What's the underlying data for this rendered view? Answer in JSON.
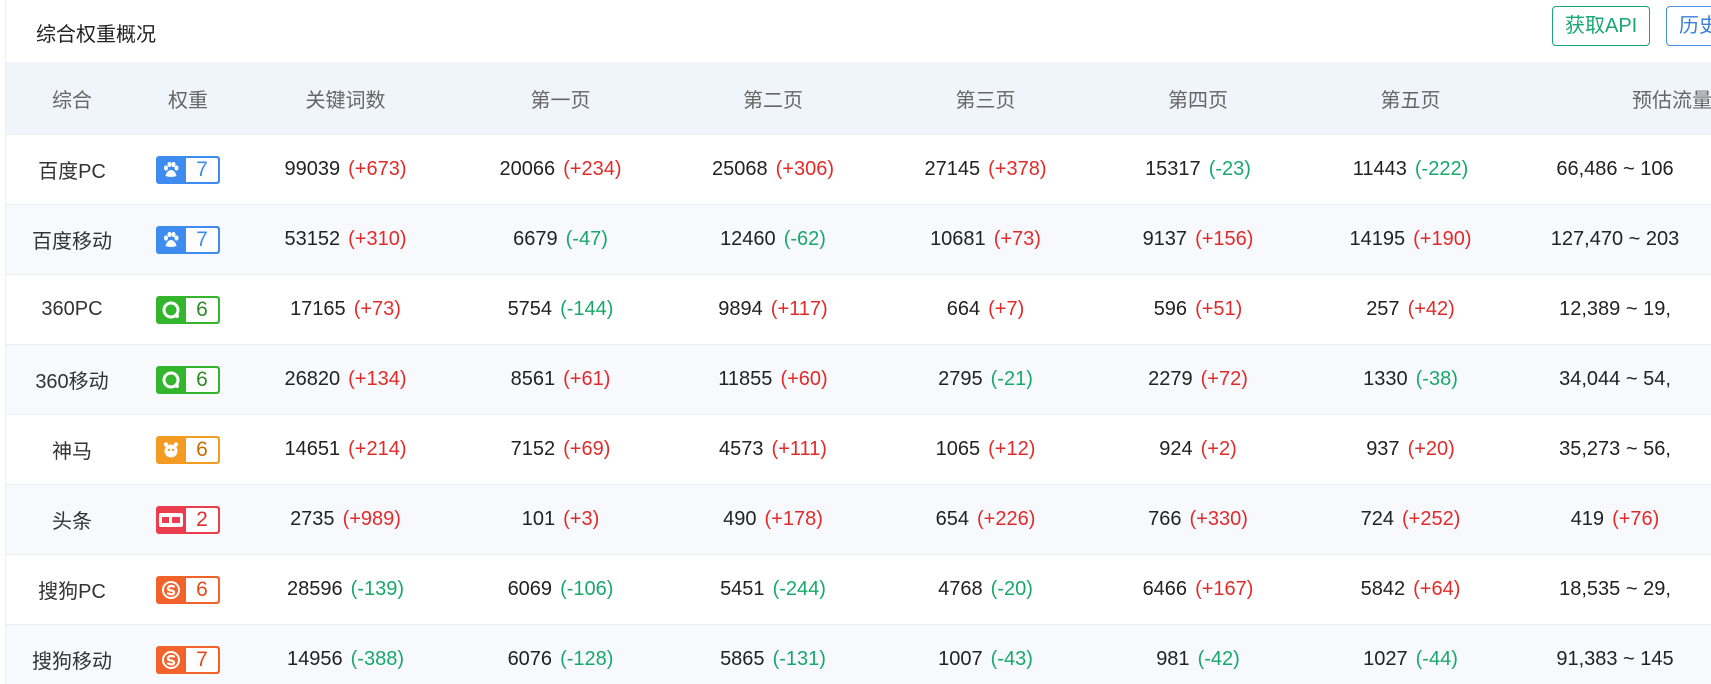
{
  "header": {
    "title": "综合权重概况",
    "api_button": "获取API",
    "history_button": "历史"
  },
  "columns": [
    "综合",
    "权重",
    "关键词数",
    "第一页",
    "第二页",
    "第三页",
    "第四页",
    "第五页",
    "预估流量"
  ],
  "rows": [
    {
      "engine": "百度PC",
      "weight": "7",
      "kw": "99039",
      "kw_d": "(+673)",
      "p1": "20066",
      "p1_d": "(+234)",
      "p2": "25068",
      "p2_d": "(+306)",
      "p3": "27145",
      "p3_d": "(+378)",
      "p4": "15317",
      "p4_d": "(-23)",
      "p5": "11443",
      "p5_d": "(-222)",
      "traffic": "66,486 ~ 106"
    },
    {
      "engine": "百度移动",
      "weight": "7",
      "kw": "53152",
      "kw_d": "(+310)",
      "p1": "6679",
      "p1_d": "(-47)",
      "p2": "12460",
      "p2_d": "(-62)",
      "p3": "10681",
      "p3_d": "(+73)",
      "p4": "9137",
      "p4_d": "(+156)",
      "p5": "14195",
      "p5_d": "(+190)",
      "traffic": "127,470 ~ 203"
    },
    {
      "engine": "360PC",
      "weight": "6",
      "kw": "17165",
      "kw_d": "(+73)",
      "p1": "5754",
      "p1_d": "(-144)",
      "p2": "9894",
      "p2_d": "(+117)",
      "p3": "664",
      "p3_d": "(+7)",
      "p4": "596",
      "p4_d": "(+51)",
      "p5": "257",
      "p5_d": "(+42)",
      "traffic": "12,389 ~ 19,"
    },
    {
      "engine": "360移动",
      "weight": "6",
      "kw": "26820",
      "kw_d": "(+134)",
      "p1": "8561",
      "p1_d": "(+61)",
      "p2": "11855",
      "p2_d": "(+60)",
      "p3": "2795",
      "p3_d": "(-21)",
      "p4": "2279",
      "p4_d": "(+72)",
      "p5": "1330",
      "p5_d": "(-38)",
      "traffic": "34,044 ~ 54,"
    },
    {
      "engine": "神马",
      "weight": "6",
      "kw": "14651",
      "kw_d": "(+214)",
      "p1": "7152",
      "p1_d": "(+69)",
      "p2": "4573",
      "p2_d": "(+111)",
      "p3": "1065",
      "p3_d": "(+12)",
      "p4": "924",
      "p4_d": "(+2)",
      "p5": "937",
      "p5_d": "(+20)",
      "traffic": "35,273 ~ 56,"
    },
    {
      "engine": "头条",
      "weight": "2",
      "kw": "2735",
      "kw_d": "(+989)",
      "p1": "101",
      "p1_d": "(+3)",
      "p2": "490",
      "p2_d": "(+178)",
      "p3": "654",
      "p3_d": "(+226)",
      "p4": "766",
      "p4_d": "(+330)",
      "p5": "724",
      "p5_d": "(+252)",
      "traffic": "419",
      "traffic_d": "(+76)"
    },
    {
      "engine": "搜狗PC",
      "weight": "6",
      "kw": "28596",
      "kw_d": "(-139)",
      "p1": "6069",
      "p1_d": "(-106)",
      "p2": "5451",
      "p2_d": "(-244)",
      "p3": "4768",
      "p3_d": "(-20)",
      "p4": "6466",
      "p4_d": "(+167)",
      "p5": "5842",
      "p5_d": "(+64)",
      "traffic": "18,535 ~ 29,"
    },
    {
      "engine": "搜狗移动",
      "weight": "7",
      "kw": "14956",
      "kw_d": "(-388)",
      "p1": "6076",
      "p1_d": "(-128)",
      "p2": "5865",
      "p2_d": "(-131)",
      "p3": "1007",
      "p3_d": "(-43)",
      "p4": "981",
      "p4_d": "(-42)",
      "p5": "1027",
      "p5_d": "(-44)",
      "traffic": "91,383 ~ 145"
    }
  ],
  "colors": {
    "increase": "#e12b2b",
    "decrease": "#18a86b",
    "header_bg": "#f0f5fb",
    "accent_green": "#17a673",
    "accent_blue": "#3a7fd8"
  },
  "badge_icons": [
    "baidu-paw-icon",
    "baidu-paw-icon",
    "qihoo-360-icon",
    "qihoo-360-icon",
    "shenma-icon",
    "toutiao-icon",
    "sogou-icon",
    "sogou-icon"
  ]
}
